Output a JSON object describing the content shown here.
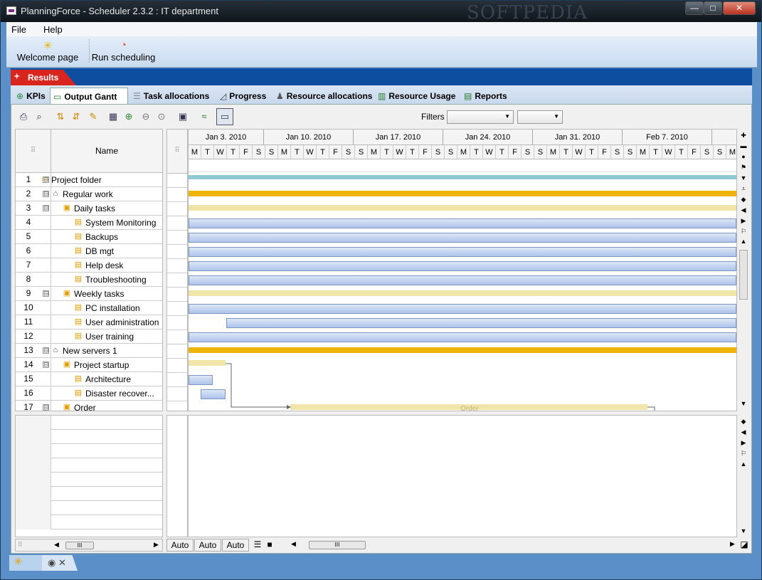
{
  "window": {
    "title": "PlanningForce - Scheduler 2.3.2 : IT department",
    "watermark": "SOFTPEDIA",
    "btn_min": "—",
    "btn_max": "□",
    "btn_close": "✕"
  },
  "menu": {
    "file": "File",
    "help": "Help"
  },
  "toolbar": {
    "welcome_label": "Welcome page",
    "run_label": "Run scheduling"
  },
  "results": {
    "label": "Results"
  },
  "tabs": [
    {
      "label": "KPIs",
      "icon": "kpi-icon"
    },
    {
      "label": "Output Gantt",
      "icon": "gantt-icon"
    },
    {
      "label": "Task allocations",
      "icon": "list-icon"
    },
    {
      "label": "Progress",
      "icon": "chart-icon"
    },
    {
      "label": "Resource allocations",
      "icon": "person-icon"
    },
    {
      "label": "Resource Usage",
      "icon": "bar-chart-icon"
    },
    {
      "label": "Reports",
      "icon": "report-icon"
    }
  ],
  "filters": {
    "label": "Filters",
    "filter1": "",
    "filter2": ""
  },
  "grid": {
    "name_header": "Name",
    "grip": "⠿"
  },
  "tasks": [
    {
      "num": "1",
      "name": "Project folder",
      "type": "folder",
      "expand": "⊟"
    },
    {
      "num": "2",
      "name": "Regular work",
      "type": "group",
      "expand": "⊟"
    },
    {
      "num": "3",
      "name": "Daily tasks",
      "type": "summary",
      "expand": "⊟"
    },
    {
      "num": "4",
      "name": "System Monitoring",
      "type": "task",
      "expand": ""
    },
    {
      "num": "5",
      "name": "Backups",
      "type": "task",
      "expand": ""
    },
    {
      "num": "6",
      "name": "DB mgt",
      "type": "task",
      "expand": ""
    },
    {
      "num": "7",
      "name": "Help desk",
      "type": "task",
      "expand": ""
    },
    {
      "num": "8",
      "name": "Troubleshooting",
      "type": "task",
      "expand": ""
    },
    {
      "num": "9",
      "name": "Weekly tasks",
      "type": "summary",
      "expand": "⊟"
    },
    {
      "num": "10",
      "name": "PC installation",
      "type": "task",
      "expand": ""
    },
    {
      "num": "11",
      "name": "User administration",
      "type": "task",
      "expand": ""
    },
    {
      "num": "12",
      "name": "User training",
      "type": "task",
      "expand": ""
    },
    {
      "num": "13",
      "name": "New servers 1",
      "type": "group",
      "expand": "⊟"
    },
    {
      "num": "14",
      "name": "Project startup",
      "type": "summary",
      "expand": "⊟"
    },
    {
      "num": "15",
      "name": "Architecture",
      "type": "task",
      "expand": ""
    },
    {
      "num": "16",
      "name": "Disaster recover...",
      "type": "task",
      "expand": ""
    },
    {
      "num": "17",
      "name": "Order",
      "type": "summary",
      "expand": "⊟"
    }
  ],
  "timeline": {
    "weeks": [
      "Jan 3. 2010",
      "Jan 10. 2010",
      "Jan 17. 2010",
      "Jan 24. 2010",
      "Jan 31. 2010",
      "Feb 7. 2010",
      "F"
    ],
    "days": [
      "M",
      "T",
      "W",
      "T",
      "F",
      "S",
      "S",
      "M",
      "T",
      "W",
      "T",
      "F",
      "S",
      "S",
      "M",
      "T",
      "W",
      "T",
      "F",
      "S",
      "S",
      "M",
      "T",
      "W",
      "T",
      "F",
      "S",
      "S",
      "M",
      "T",
      "W",
      "T",
      "F",
      "S",
      "S",
      "M",
      "T",
      "W",
      "T",
      "F",
      "S",
      "S",
      "M"
    ],
    "order_label": "Order"
  },
  "bottom": {
    "auto1": "Auto",
    "auto2": "Auto",
    "auto3": "Auto",
    "thumb": "III"
  },
  "colors": {
    "accent_blue": "#0d4ea0",
    "results_red": "#d8261e",
    "bar_orange": "#efb40a",
    "bar_light": "#f2e5aa",
    "bar_blue": "#aec4ea",
    "bar_teal": "#8ec9d4"
  }
}
